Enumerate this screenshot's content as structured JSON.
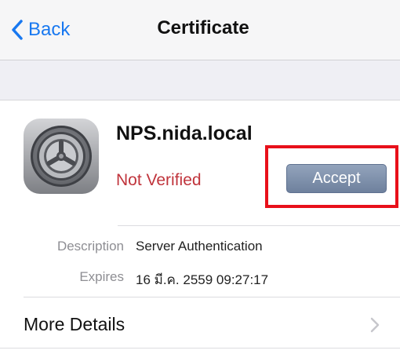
{
  "nav": {
    "back_label": "Back",
    "title": "Certificate"
  },
  "certificate": {
    "icon": "settings-gear-icon",
    "name": "NPS.nida.local",
    "status": "Not Verified",
    "accept_label": "Accept"
  },
  "details": [
    {
      "label": "Description",
      "value": "Server Authentication"
    },
    {
      "label": "Expires",
      "value": "16 มี.ค. 2559 09:27:17"
    }
  ],
  "more_details": {
    "label": "More Details"
  },
  "colors": {
    "link_blue": "#1878f0",
    "status_red": "#c0343c",
    "accept_button": "#7e90ab",
    "highlight_red": "#e8101a",
    "chevron_gray": "#c7c7cc"
  }
}
